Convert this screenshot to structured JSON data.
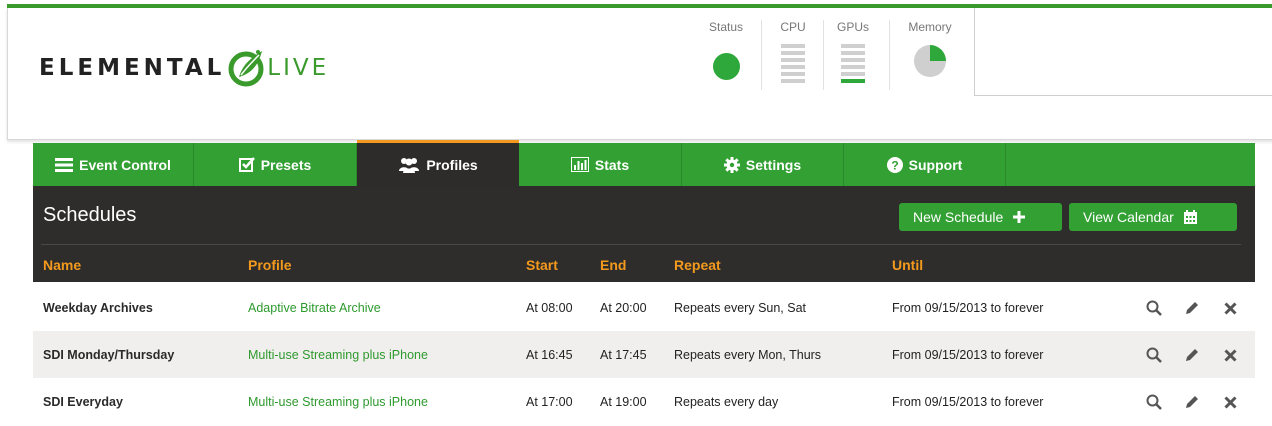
{
  "logo": {
    "part1": "ELEMENTAL",
    "part2": "LIVE"
  },
  "monitors": {
    "status_label": "Status",
    "cpu_label": "CPU",
    "gpu_label": "GPUs",
    "memory_label": "Memory",
    "memory_used_fraction": 0.25,
    "status_color": "#2ea83a"
  },
  "nav": {
    "tabs": [
      {
        "label": "Event Control",
        "icon": "list-icon"
      },
      {
        "label": "Presets",
        "icon": "checkbox-icon"
      },
      {
        "label": "Profiles",
        "icon": "people-icon",
        "active": true
      },
      {
        "label": "Stats",
        "icon": "bar-chart-icon"
      },
      {
        "label": "Settings",
        "icon": "gear-icon"
      },
      {
        "label": "Support",
        "icon": "help-icon"
      }
    ]
  },
  "panel": {
    "title": "Schedules",
    "new_button": "New Schedule",
    "calendar_button": "View Calendar"
  },
  "columns": {
    "name": "Name",
    "profile": "Profile",
    "start": "Start",
    "end": "End",
    "repeat": "Repeat",
    "until": "Until"
  },
  "rows": [
    {
      "name": "Weekday Archives",
      "profile": "Adaptive Bitrate Archive",
      "start": "At 08:00",
      "end": "At 20:00",
      "repeat": "Repeats every Sun, Sat",
      "until": "From 09/15/2013 to forever"
    },
    {
      "name": "SDI Monday/Thursday",
      "profile": "Multi-use Streaming plus iPhone",
      "start": "At 16:45",
      "end": "At 17:45",
      "repeat": "Repeats every Mon, Thurs",
      "until": "From 09/15/2013 to forever"
    },
    {
      "name": "SDI Everyday",
      "profile": "Multi-use Streaming plus iPhone",
      "start": "At 17:00",
      "end": "At 19:00",
      "repeat": "Repeats every day",
      "until": "From 09/15/2013 to forever"
    }
  ],
  "colors": {
    "accent": "#33a033",
    "header_text": "#f39a1e",
    "panel_bg": "#2f2d2b"
  }
}
